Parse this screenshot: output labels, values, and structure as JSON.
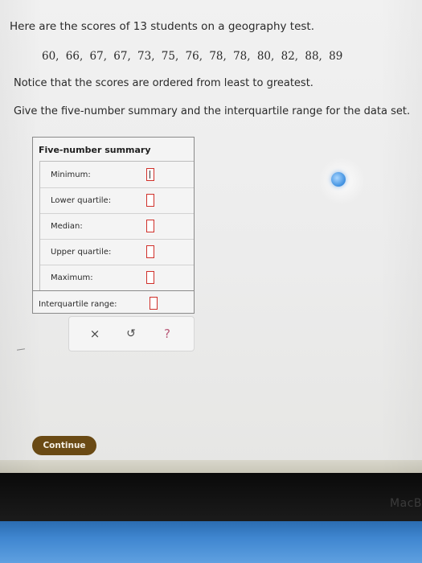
{
  "question": {
    "intro_text": "Here are the scores of 13 students on a geography test.",
    "scores_text": "60, 66, 67, 67, 73, 75, 76, 78, 78, 80, 82, 88, 89",
    "notice_text": "Notice that the scores are ordered from least to greatest.",
    "instruction_text": "Give the five-number summary and the interquartile range for the data set."
  },
  "five_number_summary": {
    "title": "Five-number summary",
    "rows": [
      {
        "label": "Minimum:",
        "value": ""
      },
      {
        "label": "Lower quartile:",
        "value": ""
      },
      {
        "label": "Median:",
        "value": ""
      },
      {
        "label": "Upper quartile:",
        "value": ""
      },
      {
        "label": "Maximum:",
        "value": ""
      }
    ],
    "iqr_label": "Interquartile range:",
    "iqr_value": ""
  },
  "actions": {
    "clear_symbol": "×",
    "undo_symbol": "↺",
    "help_symbol": "?"
  },
  "footer": {
    "continue_label": "Continue"
  },
  "device": {
    "brand_text": "MacB"
  },
  "colors": {
    "answer_box_border": "#d0302a",
    "continue_bg": "#6a4a14",
    "help_color": "#b85a78"
  },
  "icons": {
    "clear": "close-icon",
    "undo": "undo-icon",
    "help": "help-icon"
  }
}
